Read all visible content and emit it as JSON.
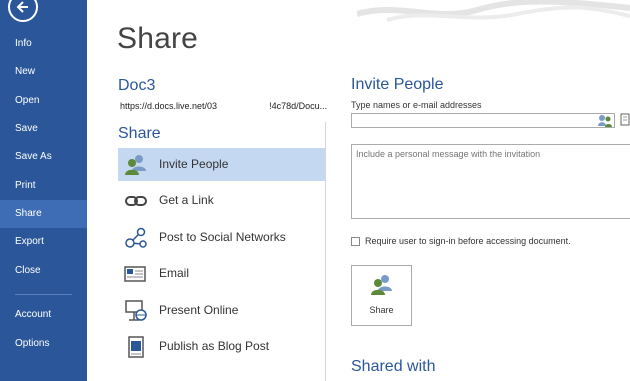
{
  "nav": {
    "back_icon": "back-arrow-icon",
    "items": [
      {
        "label": "Info"
      },
      {
        "label": "New"
      },
      {
        "label": "Open"
      },
      {
        "label": "Save"
      },
      {
        "label": "Save As"
      },
      {
        "label": "Print"
      },
      {
        "label": "Share"
      },
      {
        "label": "Export"
      },
      {
        "label": "Close"
      },
      {
        "label": "Account"
      },
      {
        "label": "Options"
      }
    ],
    "active": "Share"
  },
  "page": {
    "title": "Share",
    "doc_name": "Doc3",
    "doc_url_start": "https://d.docs.live.net/03",
    "doc_url_end": "!4c78d/Docu...",
    "section_label": "Share"
  },
  "share_options": [
    {
      "label": "Invite People",
      "icon": "invite-people-icon"
    },
    {
      "label": "Get a Link",
      "icon": "link-icon"
    },
    {
      "label": "Post to Social Networks",
      "icon": "social-networks-icon"
    },
    {
      "label": "Email",
      "icon": "email-icon"
    },
    {
      "label": "Present Online",
      "icon": "present-online-icon"
    },
    {
      "label": "Publish as Blog Post",
      "icon": "blog-post-icon"
    }
  ],
  "invite": {
    "title": "Invite People",
    "names_label": "Type names or e-mail addresses",
    "names_value": "",
    "message_placeholder": "Include a personal message with the invitation",
    "signin_label": "Require user to sign-in before accessing document.",
    "signin_checked": false,
    "share_button_label": "Share",
    "shared_with_title": "Shared with"
  },
  "colors": {
    "nav_bg": "#2b579a",
    "nav_active": "#3e6db5",
    "accent_text": "#2b579a",
    "option_selected": "#c5d8f1"
  }
}
